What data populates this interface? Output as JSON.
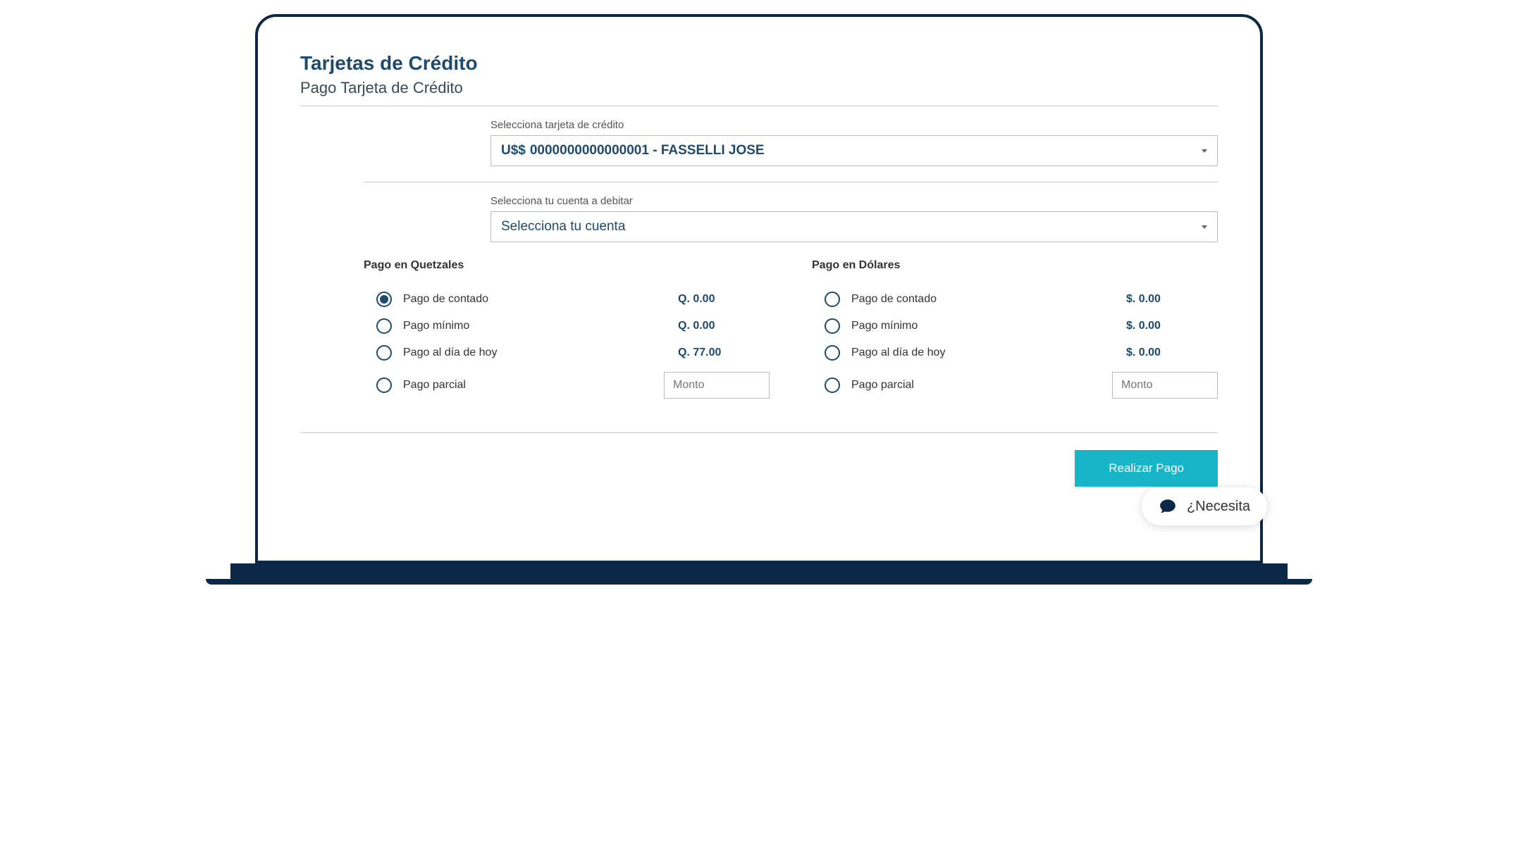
{
  "header": {
    "title": "Tarjetas de Crédito",
    "subtitle": "Pago Tarjeta de Crédito"
  },
  "card_select": {
    "label": "Selecciona tarjeta de crédito",
    "currency_prefix": "U$$",
    "value": "0000000000000001 - FASSELLI JOSE"
  },
  "account_select": {
    "label": "Selecciona tu cuenta a debitar",
    "placeholder": "Selecciona tu cuenta"
  },
  "quetzales": {
    "title": "Pago en Quetzales",
    "options": [
      {
        "label": "Pago de contado",
        "amount": "Q. 0.00",
        "selected": true
      },
      {
        "label": "Pago mínimo",
        "amount": "Q. 0.00",
        "selected": false
      },
      {
        "label": "Pago al día de hoy",
        "amount": "Q. 77.00",
        "selected": false
      },
      {
        "label": "Pago parcial",
        "amount": null,
        "selected": false,
        "input_placeholder": "Monto"
      }
    ]
  },
  "dolares": {
    "title": "Pago en Dólares",
    "options": [
      {
        "label": "Pago de contado",
        "amount": "$. 0.00",
        "selected": false
      },
      {
        "label": "Pago mínimo",
        "amount": "$. 0.00",
        "selected": false
      },
      {
        "label": "Pago al día de hoy",
        "amount": "$. 0.00",
        "selected": false
      },
      {
        "label": "Pago parcial",
        "amount": null,
        "selected": false,
        "input_placeholder": "Monto"
      }
    ]
  },
  "actions": {
    "pay_button": "Realizar Pago"
  },
  "chat": {
    "text": "¿Necesita"
  }
}
